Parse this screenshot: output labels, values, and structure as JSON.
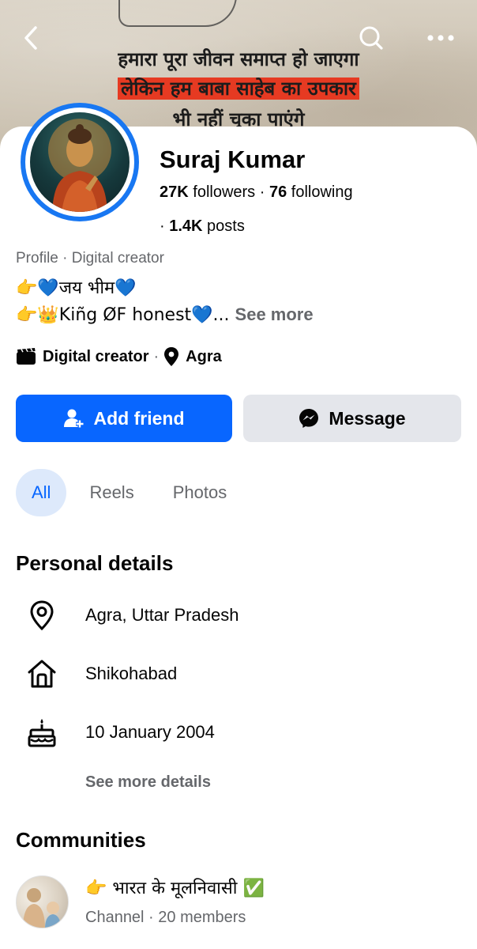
{
  "cover": {
    "line1": "हमारा पूरा जीवन समाप्त हो जाएगा",
    "line2": "लेकिन हम बाबा साहेब का उपकार",
    "line3": "भी नहीं चुका पाएंगे"
  },
  "topbar": {
    "back_icon": "chevron-left-icon",
    "search_icon": "search-icon",
    "more_icon": "more-horizontal-icon"
  },
  "profile": {
    "name": "Suraj Kumar",
    "followers_count": "27K",
    "followers_label": "followers",
    "following_count": "76",
    "following_label": "following",
    "posts_count": "1.4K",
    "posts_label": "posts",
    "type_line": "Profile · Digital creator",
    "bio_line1": "👉💙जय भीम💙",
    "bio_line2": "👉👑Kiñg ØF honest💙...",
    "see_more": "See more",
    "category": "Digital creator",
    "location_short": "Agra"
  },
  "actions": {
    "add_friend": "Add friend",
    "message": "Message"
  },
  "tabs": [
    {
      "label": "All",
      "active": true
    },
    {
      "label": "Reels",
      "active": false
    },
    {
      "label": "Photos",
      "active": false
    }
  ],
  "personal_details": {
    "title": "Personal details",
    "items": [
      {
        "icon": "location-pin-icon",
        "text": "Agra, Uttar Pradesh"
      },
      {
        "icon": "home-icon",
        "text": "Shikohabad"
      },
      {
        "icon": "birthday-cake-icon",
        "text": "10 January 2004"
      }
    ],
    "see_more": "See more details"
  },
  "communities": {
    "title": "Communities",
    "items": [
      {
        "name": "👉 भारत के मूलनिवासी ✅",
        "subtitle": "Channel · 20 members"
      }
    ]
  },
  "colors": {
    "accent": "#0866ff",
    "avatar_ring": "#1877f2",
    "secondary_button": "#e4e6eb",
    "muted_text": "#65676b",
    "active_tab_bg": "#dde9fb"
  }
}
